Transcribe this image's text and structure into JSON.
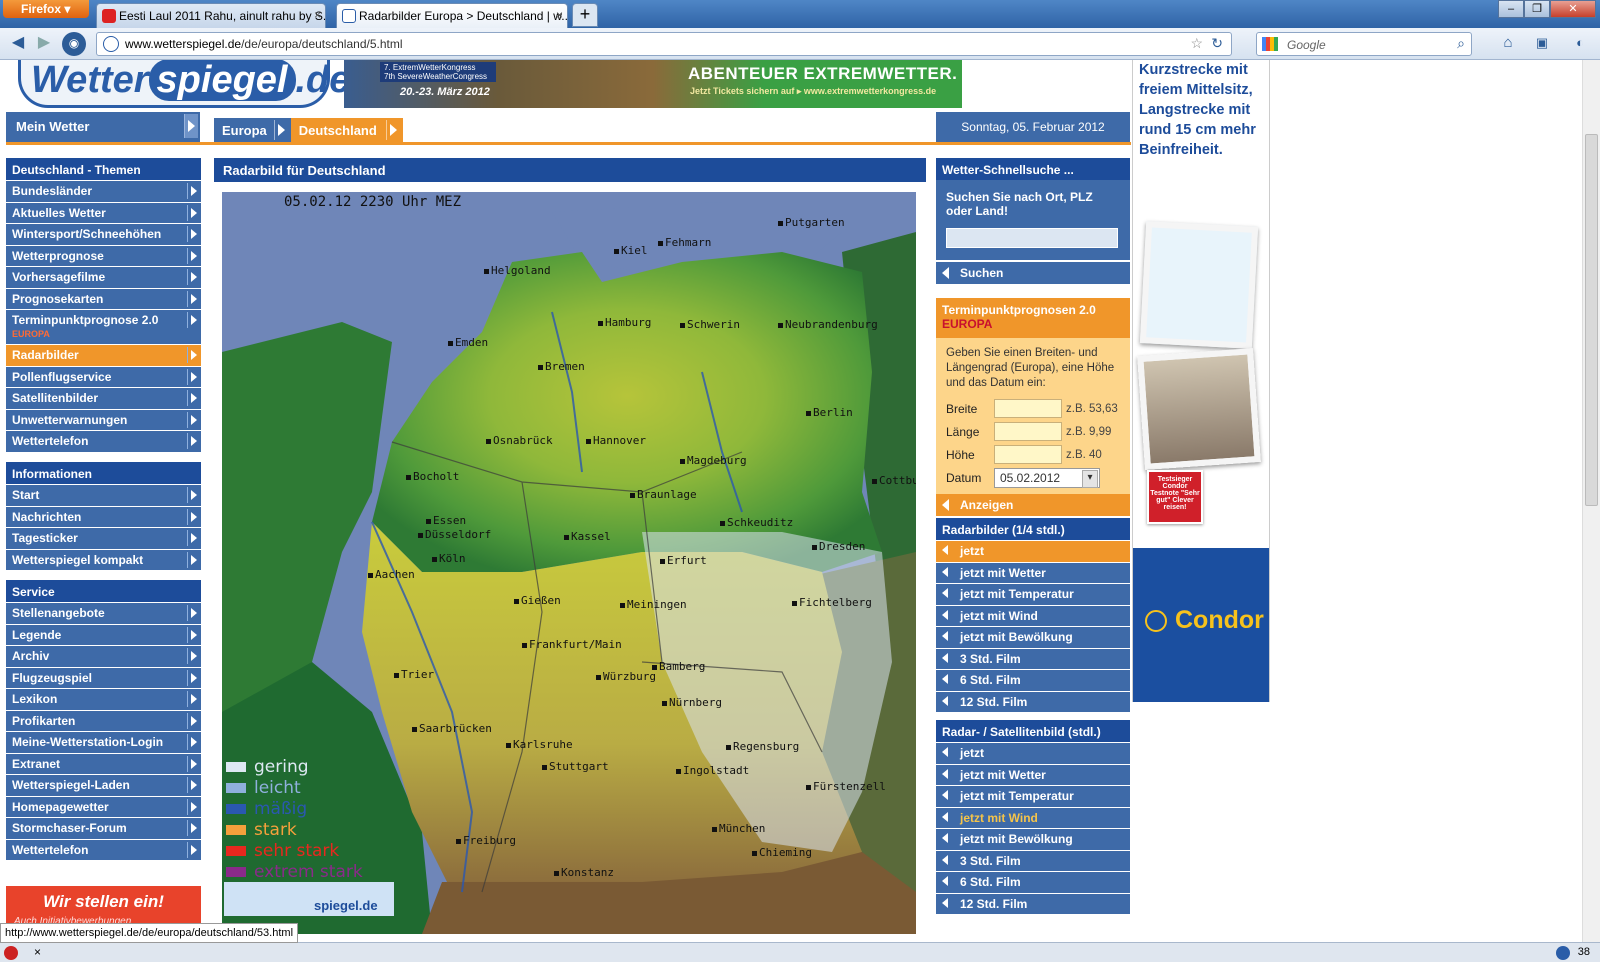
{
  "browser": {
    "app_button": "Firefox",
    "tabs": [
      {
        "title": "Eesti Laul 2011 Rahu, ainult rahu by S...",
        "active": false
      },
      {
        "title": "Radarbilder Europa > Deutschland | w...",
        "active": true
      }
    ],
    "url_domain": "www.wetterspiegel.de",
    "url_path": "/de/europa/deutschland/5.html",
    "search_placeholder": "Google",
    "status_url": "http://www.wetterspiegel.de/de/europa/deutschland/53.html",
    "status_count": "38"
  },
  "header": {
    "logo_part1": "Wetter",
    "logo_part2": "spiegel",
    "logo_part3": ".de",
    "banner_line1": "7. ExtremWetterKongress",
    "banner_line2": "7th SevereWeatherCongress",
    "banner_dates": "20.-23. März 2012",
    "banner_title": "ABENTEUER EXTREMWETTER.",
    "banner_sub": "Jetzt Tickets sichern auf ▸ www.extremwetterkongress.de",
    "mein_wetter": "Mein Wetter",
    "breadcrumb": [
      "Europa",
      "Deutschland"
    ],
    "date": "Sonntag, 05. Februar 2012"
  },
  "leftnav": {
    "themen": {
      "title": "Deutschland - Themen",
      "items": [
        "Bundesländer",
        "Aktuelles Wetter",
        "Wintersport/Schneehöhen",
        "Wetterprognose",
        "Vorhersagefilme",
        "Prognosekarten",
        "Terminpunktprognose 2.0",
        "Radarbilder",
        "Pollenflugservice",
        "Satellitenbilder",
        "Unwetterwarnungen",
        "Wettertelefon"
      ],
      "sub_label": "EUROPA",
      "selected": "Radarbilder"
    },
    "informationen": {
      "title": "Informationen",
      "items": [
        "Start",
        "Nachrichten",
        "Tagesticker",
        "Wetterspiegel kompakt"
      ]
    },
    "service": {
      "title": "Service",
      "items": [
        "Stellenangebote",
        "Legende",
        "Archiv",
        "Flugzeugspiel",
        "Lexikon",
        "Profikarten",
        "Meine-Wetterstation-Login",
        "Extranet",
        "Wetterspiegel-Laden",
        "Homepagewetter",
        "Stormchaser-Forum",
        "Wettertelefon"
      ]
    },
    "wir_stellen": "Wir stellen ein!",
    "wir_stellen_sub": "Auch Initiativbewerbungen"
  },
  "main": {
    "title": "Radarbild für Deutschland",
    "map_timestamp": "05.02.12 2230 Uhr MEZ",
    "cities": [
      {
        "name": "Putgarten"
      },
      {
        "name": "Fehmarn"
      },
      {
        "name": "Helgoland"
      },
      {
        "name": "Kiel"
      },
      {
        "name": "Hamburg"
      },
      {
        "name": "Schwerin"
      },
      {
        "name": "Neubrandenburg"
      },
      {
        "name": "Emden"
      },
      {
        "name": "Bremen"
      },
      {
        "name": "Berlin"
      },
      {
        "name": "Osnabrück"
      },
      {
        "name": "Hannover"
      },
      {
        "name": "Magdeburg"
      },
      {
        "name": "Bocholt"
      },
      {
        "name": "Braunlage"
      },
      {
        "name": "Cottbus"
      },
      {
        "name": "Essen"
      },
      {
        "name": "Düsseldorf"
      },
      {
        "name": "Schkeuditz"
      },
      {
        "name": "Kassel"
      },
      {
        "name": "Köln"
      },
      {
        "name": "Dresden"
      },
      {
        "name": "Aachen"
      },
      {
        "name": "Erfurt"
      },
      {
        "name": "Gießen"
      },
      {
        "name": "Meiningen"
      },
      {
        "name": "Fichtelberg"
      },
      {
        "name": "Frankfurt/Main"
      },
      {
        "name": "Bamberg"
      },
      {
        "name": "Trier"
      },
      {
        "name": "Würzburg"
      },
      {
        "name": "Nürnberg"
      },
      {
        "name": "Saarbrücken"
      },
      {
        "name": "Karlsruhe"
      },
      {
        "name": "Regensburg"
      },
      {
        "name": "Stuttgart"
      },
      {
        "name": "Ingolstadt"
      },
      {
        "name": "Fürstenzell"
      },
      {
        "name": "München"
      },
      {
        "name": "Freiburg"
      },
      {
        "name": "Konstanz"
      },
      {
        "name": "Chieming"
      }
    ],
    "legend": [
      {
        "label": "gering",
        "color": "#dde8f2"
      },
      {
        "label": "leicht",
        "color": "#8fb0dc"
      },
      {
        "label": "mäßig",
        "color": "#2a58b0"
      },
      {
        "label": "stark",
        "color": "#f5a03c"
      },
      {
        "label": "sehr stark",
        "color": "#e8281e"
      },
      {
        "label": "extrem stark",
        "color": "#8a2a8a"
      }
    ],
    "map_footer": "spiegel.de"
  },
  "right": {
    "quicksearch": {
      "title": "Wetter-Schnellsuche ...",
      "prompt": "Suchen Sie nach Ort, PLZ oder Land!",
      "button": "Suchen"
    },
    "terminpunkt": {
      "title": "Terminpunktprognosen 2.0",
      "title_sub": "EUROPA",
      "desc": "Geben Sie einen Breiten- und Längengrad (Europa), eine Höhe und das Datum ein:",
      "fields": [
        {
          "label": "Breite",
          "example": "z.B. 53,63"
        },
        {
          "label": "Länge",
          "example": "z.B. 9,99"
        },
        {
          "label": "Höhe",
          "example": "z.B. 40"
        }
      ],
      "date_label": "Datum",
      "date_value": "05.02.2012",
      "button": "Anzeigen"
    },
    "radarbilder": {
      "title": "Radarbilder (1/4 stdl.)",
      "items": [
        "jetzt",
        "jetzt mit Wetter",
        "jetzt mit Temperatur",
        "jetzt mit Wind",
        "jetzt mit Bewölkung",
        "3 Std. Film",
        "6 Std. Film",
        "12 Std. Film"
      ],
      "selected": "jetzt"
    },
    "radarsat": {
      "title": "Radar- / Satellitenbild (stdl.)",
      "items": [
        "jetzt",
        "jetzt mit Wetter",
        "jetzt mit Temperatur",
        "jetzt mit Wind",
        "jetzt mit Bewölkung",
        "3 Std. Film",
        "6 Std. Film",
        "12 Std. Film"
      ],
      "highlighted": "jetzt mit Wind"
    }
  },
  "ad": {
    "text": "Kurzstrecke mit freiem Mittelsitz, Langstrecke mit rund 15 cm mehr Beinfreiheit.",
    "badge": "Testsieger Condor Testnote \"Sehr gut\" Clever reisen!",
    "brand": "Condor"
  },
  "colors": {
    "nav_blue": "#3e6aa8",
    "nav_dark": "#1d4c9a",
    "accent_orange": "#f0962a"
  }
}
